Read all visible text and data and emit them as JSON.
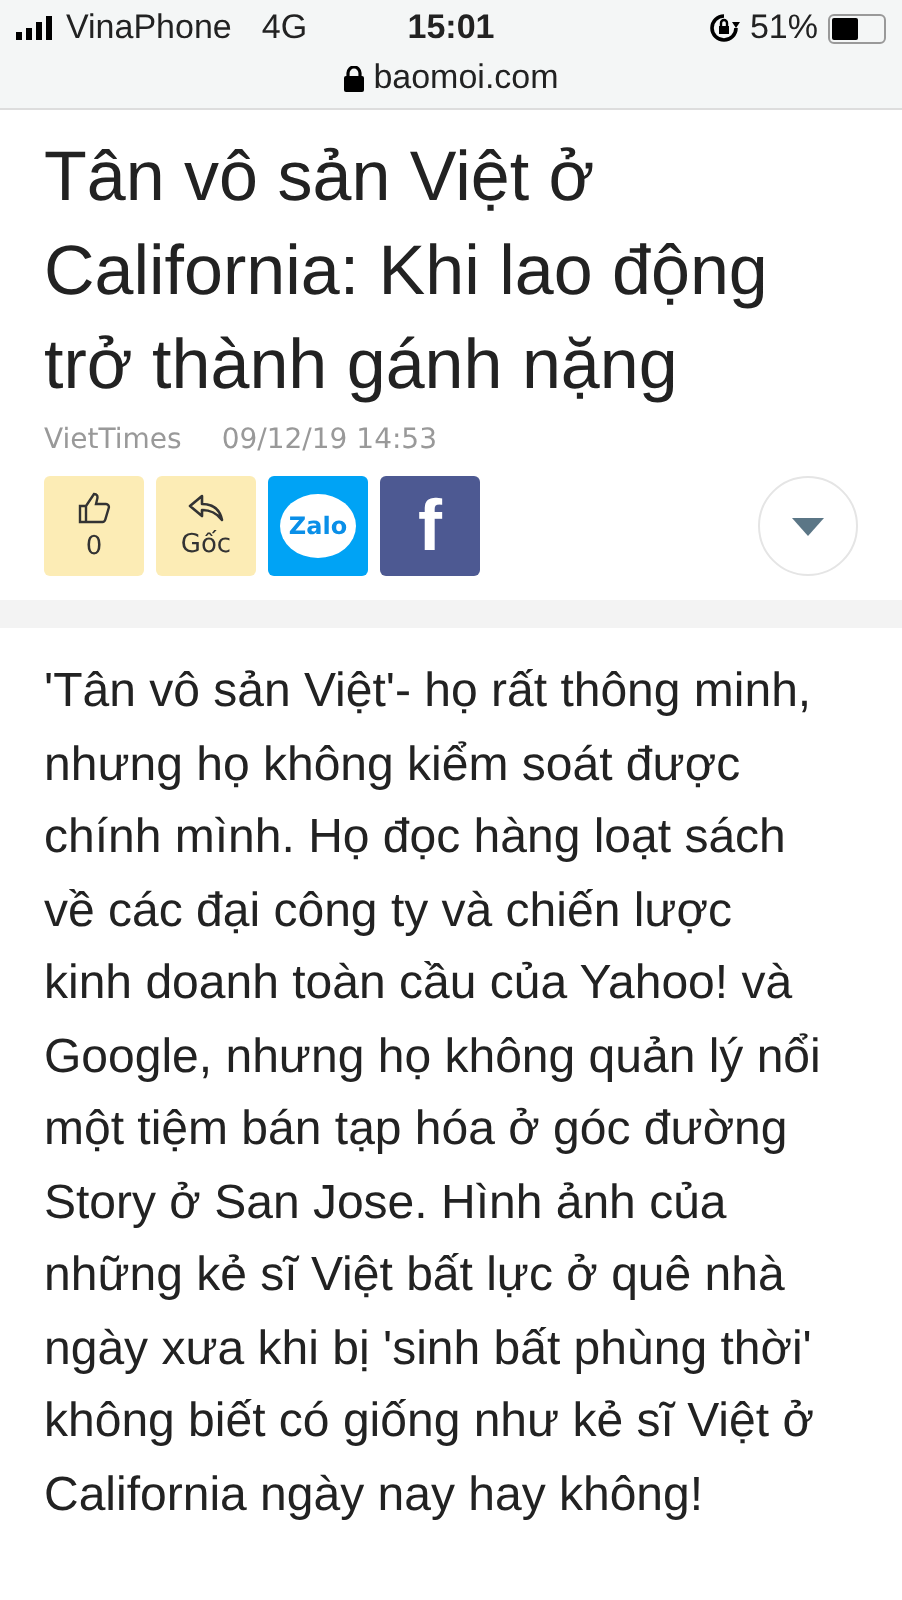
{
  "status_bar": {
    "carrier": "VinaPhone",
    "network": "4G",
    "time": "15:01",
    "battery": "51%"
  },
  "address_bar": {
    "url": "baomoi.com"
  },
  "article": {
    "title": "Tân vô sản Việt ở California: Khi lao động trở thành gánh nặng",
    "source": "VietTimes",
    "date": "09/12/19 14:53",
    "actions": [
      {
        "kind": "like",
        "label": "0"
      },
      {
        "kind": "source",
        "label": "Gốc"
      },
      {
        "kind": "zalo",
        "label": "Zalo"
      },
      {
        "kind": "facebook",
        "label": "f"
      }
    ],
    "body": "'Tân vô sản Việt'- họ rất thông minh, nhưng họ không kiểm soát được chính mình. Họ đọc hàng loạt sách về các đại công ty và chiến lược kinh doanh toàn cầu của Yahoo! và Google, nhưng họ không quản lý nổi một tiệm bán tạp hóa ở góc đường Story ở San Jose. Hình ảnh của những kẻ sĩ Việt bất lực ở quê nhà ngày xưa khi bị 'sinh bất phùng thời' không biết có giống như kẻ sĩ Việt ở California ngày nay hay không!"
  }
}
